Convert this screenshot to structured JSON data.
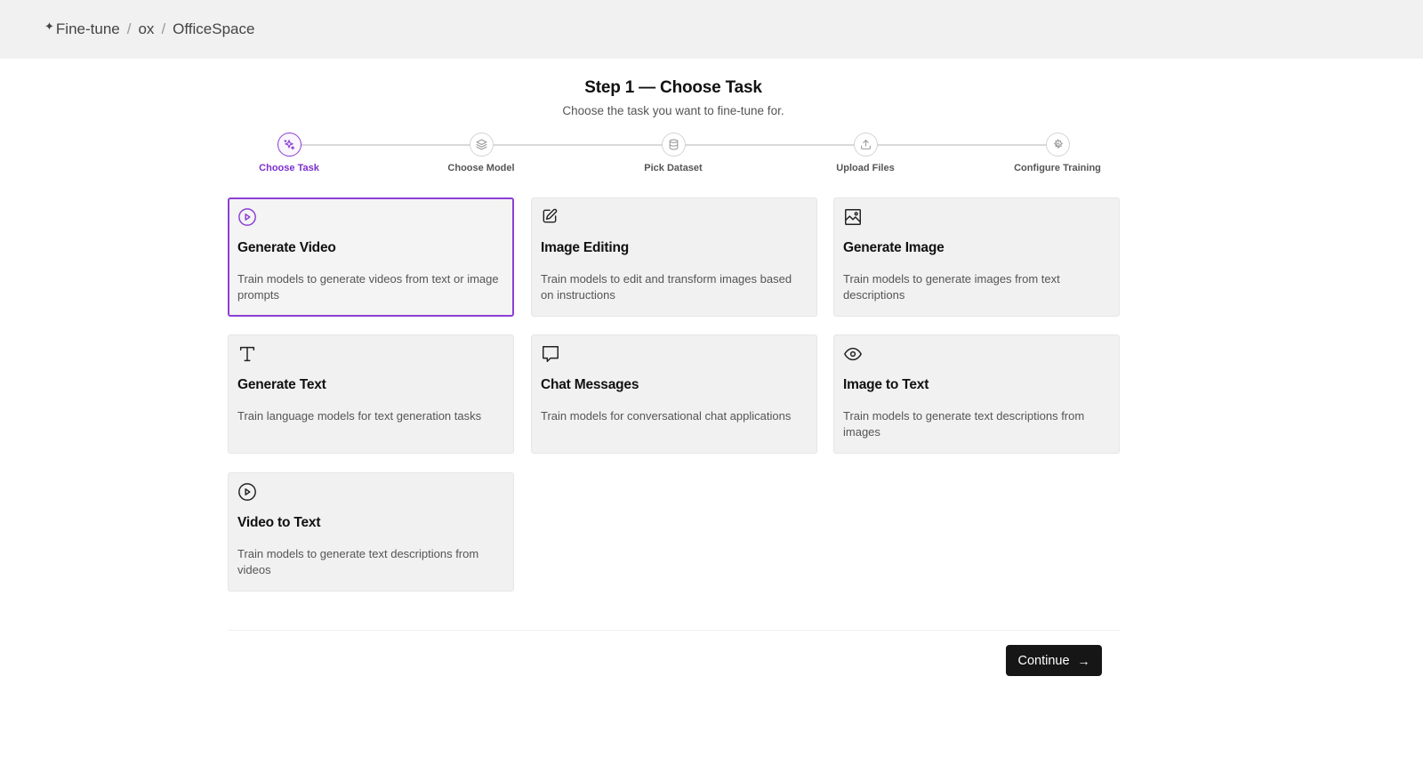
{
  "breadcrumb": {
    "root": "Fine-tune",
    "org": "ox",
    "project": "OfficeSpace",
    "separator": "/"
  },
  "header": {
    "title": "Step 1 — Choose Task",
    "subtitle": "Choose the task you want to fine-tune for."
  },
  "steps": [
    {
      "label": "Choose Task",
      "icon": "sparkles-icon",
      "active": true
    },
    {
      "label": "Choose Model",
      "icon": "layers-icon",
      "active": false
    },
    {
      "label": "Pick Dataset",
      "icon": "database-icon",
      "active": false
    },
    {
      "label": "Upload Files",
      "icon": "upload-icon",
      "active": false
    },
    {
      "label": "Configure Training",
      "icon": "settings-icon",
      "active": false
    }
  ],
  "tasks": [
    {
      "title": "Generate Video",
      "description": "Train models to generate videos from text or image prompts",
      "icon": "play-circle-icon",
      "selected": true
    },
    {
      "title": "Image Editing",
      "description": "Train models to edit and transform images based on instructions",
      "icon": "edit-icon",
      "selected": false
    },
    {
      "title": "Generate Image",
      "description": "Train models to generate images from text descriptions",
      "icon": "image-icon",
      "selected": false
    },
    {
      "title": "Generate Text",
      "description": "Train language models for text generation tasks",
      "icon": "type-icon",
      "selected": false
    },
    {
      "title": "Chat Messages",
      "description": "Train models for conversational chat applications",
      "icon": "message-square-icon",
      "selected": false
    },
    {
      "title": "Image to Text",
      "description": "Train models to generate text descriptions from images",
      "icon": "eye-icon",
      "selected": false
    },
    {
      "title": "Video to Text",
      "description": "Train models to generate text descriptions from videos",
      "icon": "play-circle-icon",
      "selected": false
    }
  ],
  "footer": {
    "continue_label": "Continue"
  },
  "colors": {
    "accent": "#8b3fd6",
    "button_bg": "#161616",
    "card_bg": "#f1f1f1"
  }
}
